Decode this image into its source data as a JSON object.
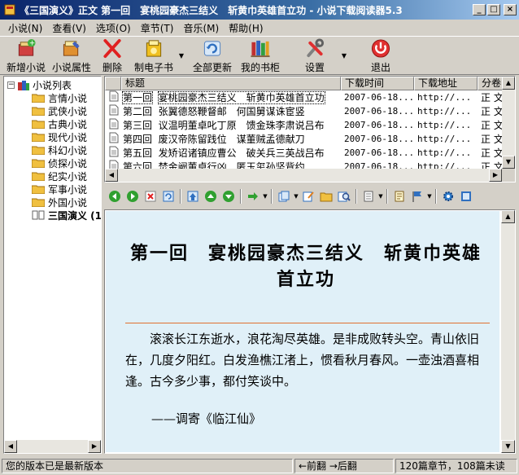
{
  "window": {
    "title": "《三国演义》正文 第一回　宴桃园豪杰三结义　斩黄巾英雄首立功 - 小说下载阅读器5.3",
    "controls": {
      "minimize": "_",
      "maximize": "□",
      "close": "×"
    }
  },
  "menu": [
    "小说(N)",
    "查看(V)",
    "选项(O)",
    "章节(T)",
    "音乐(M)",
    "帮助(H)"
  ],
  "toolbar": {
    "new_novel": "新增小说",
    "novel_props": "小说属性",
    "delete": "删除",
    "make_ebook": "制电子书",
    "update_all": "全部更新",
    "my_bookshelf": "我的书柜",
    "settings": "设置",
    "exit": "退出"
  },
  "tree": {
    "root": "小说列表",
    "items": [
      "言情小说",
      "武侠小说",
      "古典小说",
      "现代小说",
      "科幻小说",
      "侦探小说",
      "纪实小说",
      "军事小说",
      "外国小说",
      "三国演义 (1"
    ]
  },
  "list": {
    "columns": [
      "标题",
      "下载时间",
      "下载地址",
      "分卷"
    ],
    "rows": [
      {
        "ch": "第一回",
        "title": "宴桃园豪杰三结义　斩黄巾英雄首立功",
        "time": "2007-06-18...",
        "url": "http://...",
        "vol": "正 文"
      },
      {
        "ch": "第二回",
        "title": "张翼德怒鞭督邮　何国舅谋诛宦竖",
        "time": "2007-06-18...",
        "url": "http://...",
        "vol": "正 文"
      },
      {
        "ch": "第三回",
        "title": "议温明董卓叱丁原　馈金珠李肃说吕布",
        "time": "2007-06-18...",
        "url": "http://...",
        "vol": "正 文"
      },
      {
        "ch": "第四回",
        "title": "废汉帝陈留践位　谋董贼孟德献刀",
        "time": "2007-06-18...",
        "url": "http://...",
        "vol": "正 文"
      },
      {
        "ch": "第五回",
        "title": "发矫诏诸镇应曹公　破关兵三英战吕布",
        "time": "2007-06-18...",
        "url": "http://...",
        "vol": "正 文"
      },
      {
        "ch": "第六回",
        "title": "焚金阙董卓行凶　匿玉玺孙坚背约",
        "time": "2007-06-18...",
        "url": "http://...",
        "vol": "正 文"
      }
    ]
  },
  "reader": {
    "title": "第一回　宴桃园豪杰三结义　斩黄巾英雄首立功",
    "poem": "滚滚长江东逝水，浪花淘尽英雄。是非成败转头空。青山依旧在，几度夕阳红。白发渔樵江渚上，惯看秋月春风。一壶浊酒喜相逢。古今多少事，都付笑谈中。",
    "cite": "——调寄《临江仙》"
  },
  "status": {
    "version": "您的版本已是最新版本",
    "nav": "←前翻 →后翻",
    "count": "120篇章节，108篇未读"
  },
  "colors": {
    "reader_bg": "#e0f0f8",
    "rule": "#e07030",
    "title_grad_start": "#0a246a"
  }
}
